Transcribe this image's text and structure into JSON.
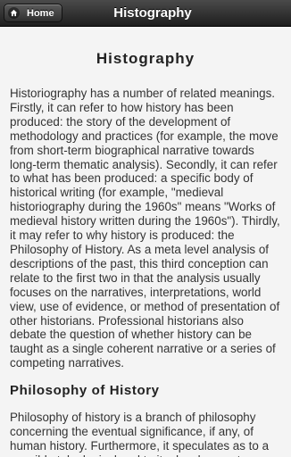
{
  "header": {
    "home_label": "Home",
    "title": "Histography",
    "home_icon": "home-icon"
  },
  "main": {
    "page_title": "Histography",
    "intro_paragraph": "Historiography has a number of related meanings. Firstly, it can refer to how history has been produced: the story of the development of methodology and practices (for example, the move from short-term biographical narrative towards long-term thematic analysis). Secondly, it can refer to what has been produced: a specific body of historical writing (for example, \"medieval historiography during the 1960s\" means \"Works of medieval history written during the 1960s\"). Thirdly, it may refer to why history is produced: the Philosophy of History. As a meta level analysis of descriptions of the past, this third conception can relate to the first two in that the analysis usually focuses on the narratives, interpretations, world view, use of evidence, or method of presentation of other historians. Professional historians also debate the question of whether history can be taught as a single coherent narrative or a series of competing narratives.",
    "section_heading": "Philosophy of History",
    "section_paragraph": "Philosophy of history is a branch of philosophy concerning the eventual significance, if any, of human history. Furthermore, it speculates as to a possible teleological end to its development"
  },
  "colors": {
    "header_background": "#2a2a2a",
    "page_background": "#f4f4f4",
    "text": "#333333"
  }
}
